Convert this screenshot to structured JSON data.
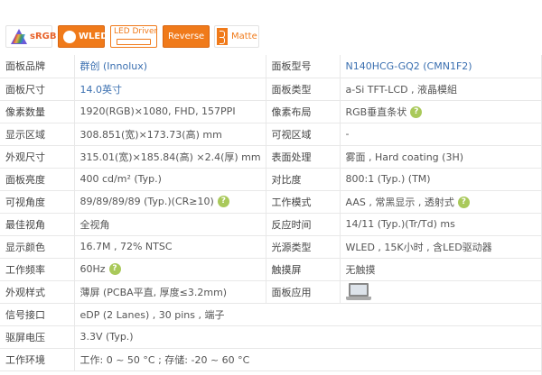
{
  "badges": {
    "srgb": "sRGB",
    "wled": "WLED",
    "led_driver": "LED Driver",
    "reverse": "Reverse",
    "matte": "Matte"
  },
  "rows": [
    {
      "l1": "面板品牌",
      "v1": "群创 (Innolux)",
      "l2": "面板型号",
      "v2": "N140HCG-GQ2 (CMN1F2)"
    },
    {
      "l1": "面板尺寸",
      "v1": "14.0英寸",
      "l2": "面板类型",
      "v2": "a-Si TFT-LCD , 液晶模組"
    },
    {
      "l1": "像素数量",
      "v1": "1920(RGB)×1080, FHD, 157PPI",
      "l2": "像素布局",
      "v2": "RGB垂直条状"
    },
    {
      "l1": "显示区域",
      "v1": "308.851(宽)×173.73(高) mm",
      "l2": "可视区域",
      "v2": "-"
    },
    {
      "l1": "外观尺寸",
      "v1": "315.01(宽)×185.84(高) ×2.4(厚) mm",
      "l2": "表面处理",
      "v2": "雾面 , Hard coating (3H)"
    },
    {
      "l1": "面板亮度",
      "v1": "400 cd/m² (Typ.)",
      "l2": "对比度",
      "v2": "800:1 (Typ.) (TM)"
    },
    {
      "l1": "可视角度",
      "v1": "89/89/89/89 (Typ.)(CR≥10)",
      "l2": "工作模式",
      "v2": "AAS , 常黑显示 , 透射式"
    },
    {
      "l1": "最佳视角",
      "v1": "全视角",
      "l2": "反应时间",
      "v2": "14/11 (Typ.)(Tr/Td) ms"
    },
    {
      "l1": "显示颜色",
      "v1": "16.7M , 72% NTSC",
      "l2": "光源类型",
      "v2": "WLED , 15K小时 , 含LED驱动器"
    },
    {
      "l1": "工作频率",
      "v1": "60Hz",
      "l2": "触摸屏",
      "v2": "无触摸"
    },
    {
      "l1": "外观样式",
      "v1": "薄屏 (PCBA平直, 厚度≤3.2mm)",
      "l2": "面板应用",
      "v2": ""
    },
    {
      "l1": "信号接口",
      "v1": "eDP (2 Lanes) , 30 pins , 端子"
    },
    {
      "l1": "驱屏电压",
      "v1": "3.3V (Typ.)"
    },
    {
      "l1": "工作环境",
      "v1": "工作: 0 ~ 50 °C ; 存储: -20 ~ 60 °C"
    }
  ],
  "help_glyph": "?"
}
